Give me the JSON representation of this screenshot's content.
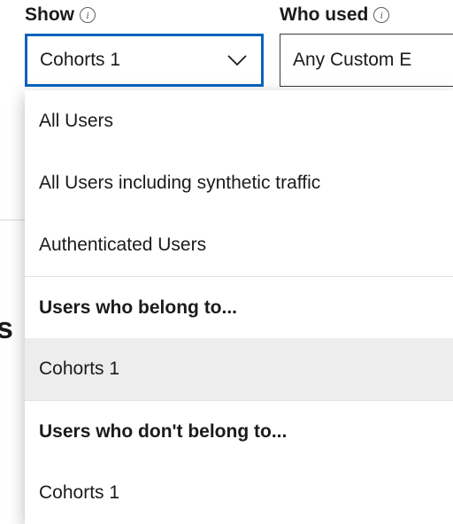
{
  "fields": {
    "show": {
      "label": "Show",
      "selected": "Cohorts 1"
    },
    "who_used": {
      "label": "Who used",
      "selected": "Any Custom E"
    }
  },
  "dropdown": {
    "items": [
      {
        "label": "All Users",
        "type": "option"
      },
      {
        "label": "All Users including synthetic traffic",
        "type": "option"
      },
      {
        "label": "Authenticated Users",
        "type": "option"
      },
      {
        "label": "Users who belong to...",
        "type": "header"
      },
      {
        "label": "Cohorts 1",
        "type": "option",
        "selected": true
      },
      {
        "label": "Users who don't belong to...",
        "type": "header"
      },
      {
        "label": "Cohorts 1",
        "type": "option"
      }
    ]
  },
  "left_edge_char": "s"
}
